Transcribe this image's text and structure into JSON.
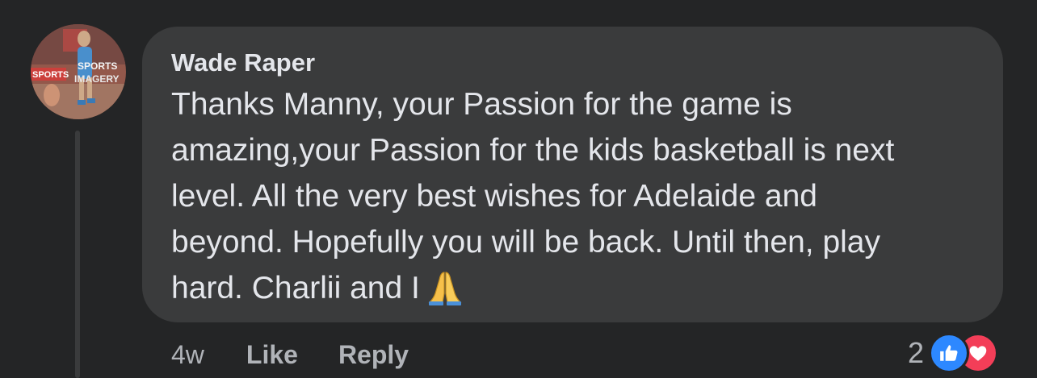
{
  "comment": {
    "author": "Wade Raper",
    "text_lines": [
      "Thanks Manny, your Passion for the game is",
      "amazing,your Passion for the kids basketball is next",
      "level. All the very best wishes for Adelaide and",
      "beyond. Hopefully you will be back. Until then, play",
      "hard. Charlii and I"
    ],
    "emoji": "folded-hands-emoji",
    "avatar": {
      "brand_lines": [
        "SPORTS",
        "IMAGERY"
      ],
      "badge": "SPORTS"
    }
  },
  "actions": {
    "time": "4w",
    "like_label": "Like",
    "reply_label": "Reply"
  },
  "reactions": {
    "count": "2",
    "types": [
      "like-icon",
      "love-icon"
    ]
  },
  "colors": {
    "background": "#242526",
    "bubble": "#3a3b3c",
    "text_primary": "#e4e6eb",
    "text_secondary": "#b0b3b8",
    "like_blue": "#2d88ff",
    "love_red": "#f33e58"
  }
}
